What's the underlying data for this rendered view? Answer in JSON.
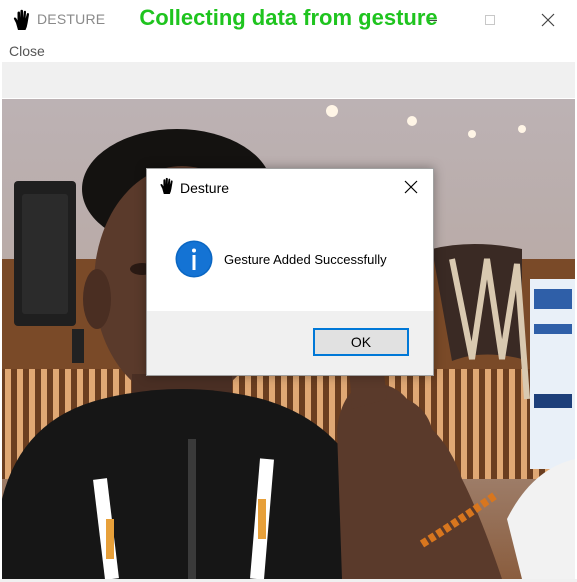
{
  "window": {
    "title": "DESTURE",
    "app_icon": "hand-icon"
  },
  "menu": {
    "items": [
      "Close"
    ]
  },
  "heading": {
    "text": "Collecting data from gesture",
    "color": "#1fc41f"
  },
  "dialog": {
    "title": "Desture",
    "title_icon": "hand-icon",
    "icon": "info-icon",
    "message": "Gesture Added Successfully",
    "ok_label": "OK",
    "accent": "#0078d7"
  }
}
